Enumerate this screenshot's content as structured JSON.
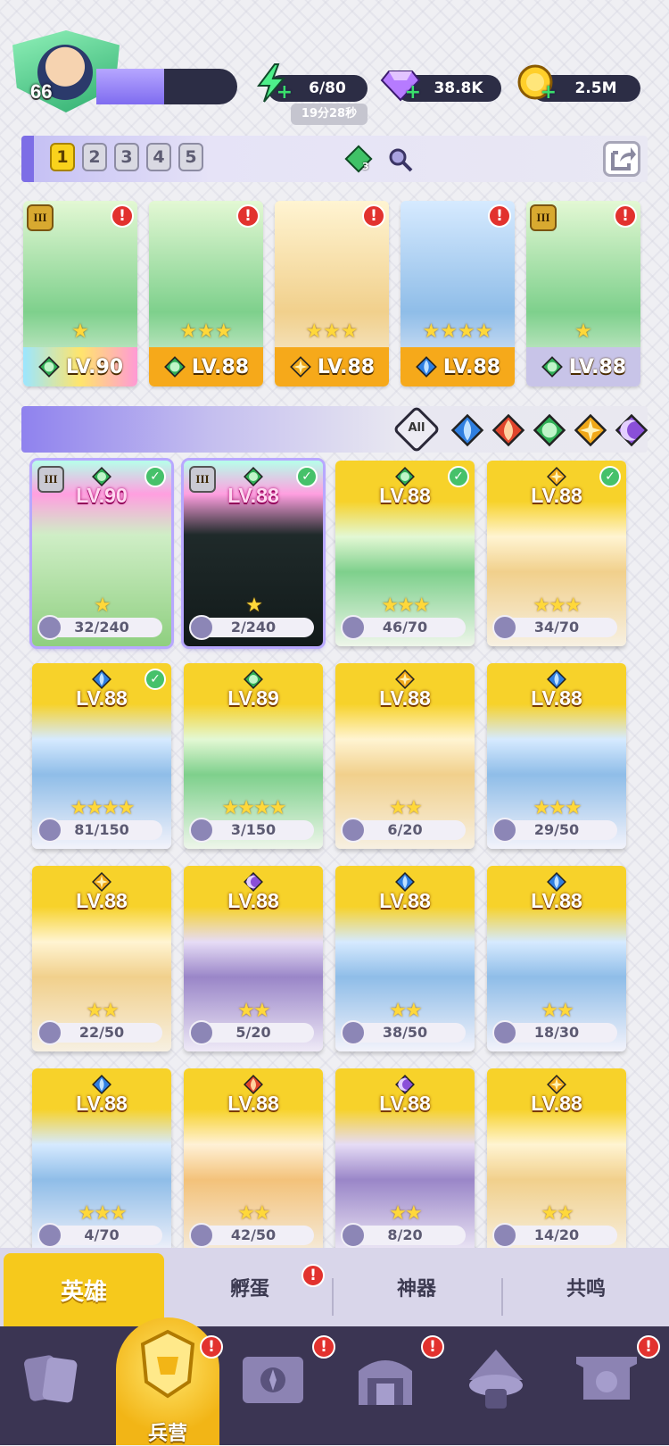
{
  "player": {
    "level": "66",
    "xp_fraction": 0.48
  },
  "resources": {
    "energy": "6/80",
    "energy_timer": "19分28秒",
    "gems": "38.8K",
    "gold": "2.5M"
  },
  "team_tabs": [
    "1",
    "2",
    "3",
    "4",
    "5"
  ],
  "active_team_tab": "1",
  "element_gem_count": "3",
  "team": [
    {
      "level": "LV.90",
      "element": "earth",
      "stars": 1,
      "rank": "III"
    },
    {
      "level": "LV.88",
      "element": "earth",
      "stars": 3,
      "rank": ""
    },
    {
      "level": "LV.88",
      "element": "light",
      "stars": 3,
      "rank": ""
    },
    {
      "level": "LV.88",
      "element": "water",
      "stars": 4,
      "rank": ""
    },
    {
      "level": "LV.88",
      "element": "earth",
      "stars": 1,
      "rank": "III"
    }
  ],
  "filters": {
    "all_label": "All",
    "elements": [
      "water",
      "fire",
      "earth",
      "light",
      "dark"
    ]
  },
  "heroes": [
    {
      "level": "LV.90",
      "element": "earth",
      "stars": 1,
      "progress": "32/240",
      "rank": "III",
      "checked": true,
      "glow": true
    },
    {
      "level": "LV.88",
      "element": "earth",
      "stars": 1,
      "progress": "2/240",
      "rank": "III",
      "checked": true,
      "glow": true
    },
    {
      "level": "LV.88",
      "element": "earth",
      "stars": 3,
      "progress": "46/70",
      "rank": "",
      "checked": true,
      "glow": false
    },
    {
      "level": "LV.88",
      "element": "light",
      "stars": 3,
      "progress": "34/70",
      "rank": "",
      "checked": true,
      "glow": false
    },
    {
      "level": "LV.88",
      "element": "water",
      "stars": 4,
      "progress": "81/150",
      "rank": "",
      "checked": true,
      "glow": false
    },
    {
      "level": "LV.89",
      "element": "earth",
      "stars": 4,
      "progress": "3/150",
      "rank": "",
      "checked": false,
      "glow": false
    },
    {
      "level": "LV.88",
      "element": "light",
      "stars": 2,
      "progress": "6/20",
      "rank": "",
      "checked": false,
      "glow": false
    },
    {
      "level": "LV.88",
      "element": "water",
      "stars": 3,
      "progress": "29/50",
      "rank": "",
      "checked": false,
      "glow": false
    },
    {
      "level": "LV.88",
      "element": "light",
      "stars": 2,
      "progress": "22/50",
      "rank": "",
      "checked": false,
      "glow": false
    },
    {
      "level": "LV.88",
      "element": "dark",
      "stars": 2,
      "progress": "5/20",
      "rank": "",
      "checked": false,
      "glow": false
    },
    {
      "level": "LV.88",
      "element": "water",
      "stars": 2,
      "progress": "38/50",
      "rank": "",
      "checked": false,
      "glow": false
    },
    {
      "level": "LV.88",
      "element": "water",
      "stars": 2,
      "progress": "18/30",
      "rank": "",
      "checked": false,
      "glow": false
    },
    {
      "level": "LV.88",
      "element": "water",
      "stars": 3,
      "progress": "4/70",
      "rank": "",
      "checked": false,
      "glow": false
    },
    {
      "level": "LV.88",
      "element": "fire",
      "stars": 2,
      "progress": "42/50",
      "rank": "",
      "checked": false,
      "glow": false
    },
    {
      "level": "LV.88",
      "element": "dark",
      "stars": 2,
      "progress": "8/20",
      "rank": "",
      "checked": false,
      "glow": false
    },
    {
      "level": "LV.88",
      "element": "light",
      "stars": 2,
      "progress": "14/20",
      "rank": "",
      "checked": false,
      "glow": false
    }
  ],
  "tabs": {
    "heroes": "英雄",
    "hatch": "孵蛋",
    "artifacts": "神器",
    "resonance": "共鸣"
  },
  "nav": {
    "barracks": "兵营"
  },
  "alert_mark": "!",
  "check_mark": "✓",
  "colors": {
    "accent": "#7d6ee6",
    "gold": "#f6c91c",
    "water": "#2f7fe0",
    "fire": "#e0452c",
    "earth": "#2fae55",
    "light": "#f0a818",
    "dark": "#8a4fd8"
  }
}
